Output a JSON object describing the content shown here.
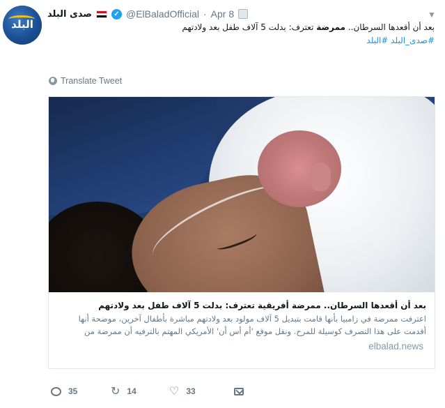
{
  "tweet": {
    "author_name": "صدى البلد",
    "handle": "@ElBaladOfficial",
    "separator": "·",
    "date": "Apr 8",
    "text_prefix": "بعد أن أقعدها السرطان.. ",
    "text_bold": "ممرضة",
    "text_suffix": " تعترف: بدلت 5 آلاف طفل بعد ولادتهم",
    "hashtags": "#صدى_البلد #البلد",
    "translate_label": "Translate Tweet"
  },
  "avatar": {
    "logo_text": "البلد"
  },
  "card": {
    "title": "بعد أن أقعدها السرطان.. ممرضة أفريقية تعترف: بدلت 5 آلاف طفل بعد ولادتهم",
    "description": "اعترفت ممرضة في زامبيا بأنها قامت بتبديل 5 آلاف مولود بعد ولادتهم مباشرة بأطفال آخرين، موضحة أنها أقدمت على هذا التصرف كوسيلة للمرح. ونقل موقع 'أم أس أن' الأمريكي المهتم بالترفيه أن ممرضة من",
    "domain": "elbalad.news"
  },
  "actions": {
    "reply_count": "35",
    "retweet_count": "14",
    "like_count": "33"
  },
  "icons": {
    "verified": "verified-badge-icon",
    "flag": "egypt-flag-icon",
    "globe": "globe-icon",
    "reply": "reply-icon",
    "retweet": "retweet-icon",
    "like": "heart-icon",
    "dm": "direct-message-icon",
    "caret": "chevron-down-icon"
  },
  "colors": {
    "link": "#1b95e0",
    "verified": "#1da1f2",
    "muted": "#657786"
  }
}
